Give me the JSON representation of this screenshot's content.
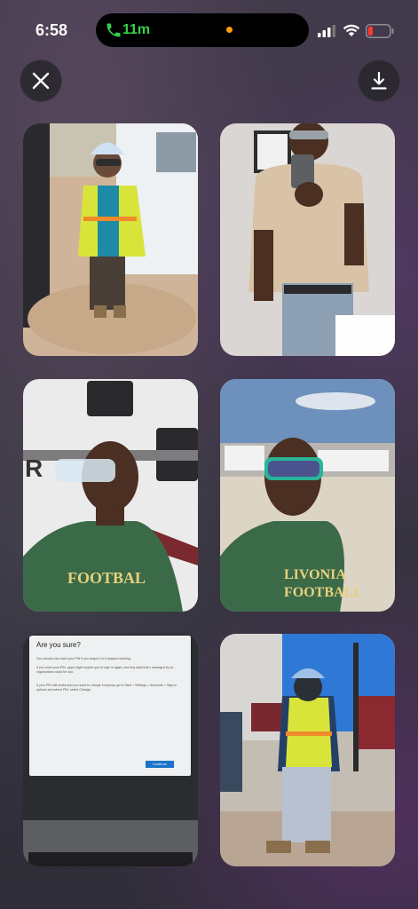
{
  "status_bar": {
    "time": "6:58",
    "call_duration": "11m",
    "icons": [
      "phone-icon",
      "signal-icon",
      "wifi-icon",
      "battery-icon"
    ],
    "battery_color": "#ff3b30",
    "call_color": "#35d04b",
    "mic_indicator_color": "#ff9f0a"
  },
  "toolbar": {
    "close_icon": "close-icon",
    "download_icon": "download-icon"
  },
  "photos": [
    {
      "label": "photo-1"
    },
    {
      "label": "photo-2"
    },
    {
      "label": "photo-3"
    },
    {
      "label": "photo-4"
    },
    {
      "label": "photo-5"
    },
    {
      "label": "photo-6"
    }
  ],
  "laptop_dialog": {
    "title": "Are you sure?",
    "text_1": "You should only reset your PIN if you forgot it or it stopped working.",
    "text_2": "If you reset your PIN, apps might require you to sign in again, and any data that's managed by an organization could be lost.",
    "text_3": "If your PIN still works and you want to change it anyway, go to Start > Settings > Accounts > Sign-in options and select PIN, select Change.",
    "button": "Continue"
  }
}
